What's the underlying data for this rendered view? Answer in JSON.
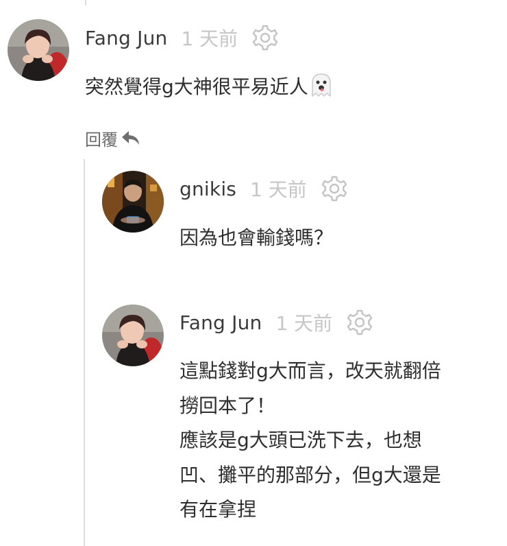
{
  "comments": [
    {
      "author": "Fang Jun",
      "time": "1 天前",
      "avatar_icon": "avatar-fangjun",
      "lines": [
        "突然覺得g大神很平易近人"
      ],
      "emoji": "ghost-emoji",
      "reply_label": "回覆"
    },
    {
      "author": "gnikis",
      "time": "1 天前",
      "avatar_icon": "avatar-gnikis",
      "lines": [
        "因為也會輸錢嗎？"
      ]
    },
    {
      "author": "Fang Jun",
      "time": "1 天前",
      "avatar_icon": "avatar-fangjun",
      "lines": [
        "這點錢對g大而言，改天就翻倍",
        "撈回本了！",
        "應該是g大頭已洗下去，也想",
        "凹、攤平的那部分，但g大還是",
        "有在拿捏"
      ]
    }
  ],
  "icons": {
    "settings": "gear-icon",
    "reply": "reply-arrow-icon"
  },
  "colors": {
    "author": "#3a3a3a",
    "time": "#c6c6c6",
    "body": "#2e2e2e",
    "thread_line": "#dcdcdc"
  }
}
